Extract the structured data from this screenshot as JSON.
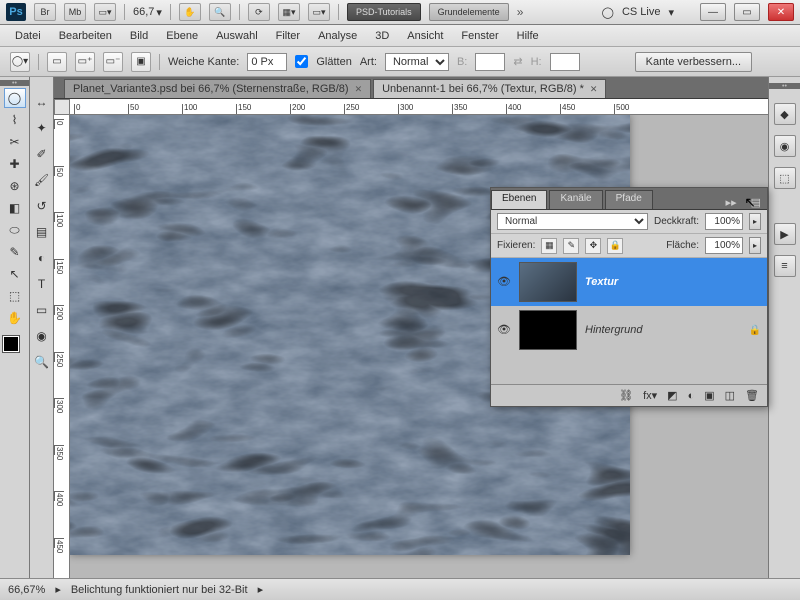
{
  "appbar": {
    "zoom": "66,7",
    "tag1": "PSD-Tutorials",
    "tag2": "Grundelemente",
    "cslive": "CS Live"
  },
  "menu": [
    "Datei",
    "Bearbeiten",
    "Bild",
    "Ebene",
    "Auswahl",
    "Filter",
    "Analyse",
    "3D",
    "Ansicht",
    "Fenster",
    "Hilfe"
  ],
  "options": {
    "feather_lbl": "Weiche Kante:",
    "feather_val": "0 Px",
    "antialias": "Glätten",
    "style_lbl": "Art:",
    "style_val": "Normal",
    "w_lbl": "B:",
    "h_lbl": "H:",
    "refine": "Kante verbessern..."
  },
  "tabs": [
    {
      "label": "Planet_Variante3.psd bei 66,7% (Sternenstraße, RGB/8)",
      "active": false
    },
    {
      "label": "Unbenannt-1 bei 66,7% (Textur, RGB/8) *",
      "active": true
    }
  ],
  "layers_panel": {
    "tabs": [
      "Ebenen",
      "Kanäle",
      "Pfade"
    ],
    "blend": "Normal",
    "opacity_lbl": "Deckkraft:",
    "opacity_val": "100%",
    "lock_lbl": "Fixieren:",
    "fill_lbl": "Fläche:",
    "fill_val": "100%",
    "layers": [
      {
        "name": "Textur",
        "sel": true,
        "locked": false
      },
      {
        "name": "Hintergrund",
        "sel": false,
        "locked": true
      }
    ]
  },
  "status": {
    "zoom": "66,67%",
    "msg": "Belichtung funktioniert nur bei 32-Bit"
  },
  "ruler_marks": [
    0,
    50,
    100,
    150,
    200,
    250,
    300,
    350,
    400,
    450,
    500
  ]
}
